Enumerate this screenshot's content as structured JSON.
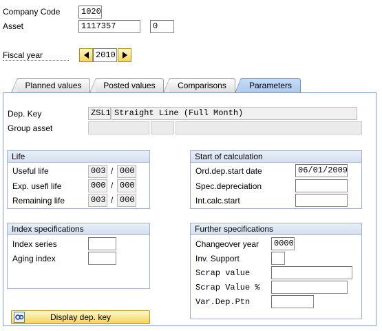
{
  "header": {
    "company_code_label": "Company Code",
    "company_code_value": "1020",
    "asset_label": "Asset",
    "asset_value": "1117357",
    "asset_sub_value": "0",
    "fiscal_year_label": "Fiscal year",
    "fiscal_year_value": "2010"
  },
  "tabs": [
    {
      "label": "Planned values"
    },
    {
      "label": "Posted values"
    },
    {
      "label": "Comparisons"
    },
    {
      "label": "Parameters",
      "active": true
    }
  ],
  "dep_key": {
    "label": "Dep. Key",
    "code": "ZSL1",
    "description": "Straight Line (Full Month)"
  },
  "group_asset": {
    "label": "Group asset"
  },
  "life": {
    "title": "Life",
    "rows": [
      {
        "label": "Useful life",
        "years": "003",
        "periods": "000"
      },
      {
        "label": "Exp. usefl life",
        "years": "000",
        "periods": "000"
      },
      {
        "label": "Remaining life",
        "years": "003",
        "periods": "000"
      }
    ],
    "separator": "/"
  },
  "start_of_calculation": {
    "title": "Start of calculation",
    "ord_dep_label": "Ord.dep.start date",
    "ord_dep_value": "06/01/2009",
    "spec_dep_label": "Spec.depreciation",
    "spec_dep_value": "",
    "int_calc_label": "Int.calc.start",
    "int_calc_value": ""
  },
  "index_specifications": {
    "title": "Index specifications",
    "index_series_label": "Index series",
    "index_series_value": "",
    "aging_index_label": "Aging index",
    "aging_index_value": ""
  },
  "further_specifications": {
    "title": "Further specifications",
    "changeover_year_label": "Changeover year",
    "changeover_year_value": "0000",
    "inv_support_label": "Inv. Support",
    "inv_support_value": "",
    "scrap_value_label": "Scrap value",
    "scrap_value_value": "",
    "scrap_value_pct_label": "Scrap Value %",
    "scrap_value_pct_value": "",
    "var_dep_ptn_label": "Var.Dep.Ptn",
    "var_dep_ptn_value": ""
  },
  "actions": {
    "display_dep_key_label": "Display dep. key",
    "display_dep_key_icon": "display-glasses-icon"
  },
  "colors": {
    "accent_yellow": "#f3d45a",
    "tab_active": "#a9c6ec",
    "group_header": "#d4dfef"
  }
}
